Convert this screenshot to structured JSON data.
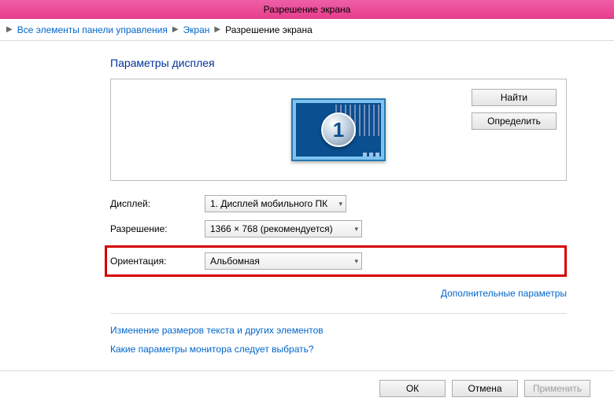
{
  "window": {
    "title": "Разрешение экрана"
  },
  "breadcrumb": {
    "item0": "Все элементы панели управления",
    "item1": "Экран",
    "item2": "Разрешение экрана"
  },
  "heading": "Параметры дисплея",
  "buttons": {
    "find": "Найти",
    "detect": "Определить"
  },
  "monitor_number": "1",
  "fields": {
    "display_label": "Дисплей:",
    "display_value": "1. Дисплей мобильного ПК",
    "resolution_label": "Разрешение:",
    "resolution_value": "1366 × 768 (рекомендуется)",
    "orientation_label": "Ориентация:",
    "orientation_value": "Альбомная"
  },
  "links": {
    "advanced": "Дополнительные параметры",
    "text_size": "Изменение размеров текста и других элементов",
    "which_monitor": "Какие параметры монитора следует выбрать?"
  },
  "footer": {
    "ok": "ОК",
    "cancel": "Отмена",
    "apply": "Применить"
  }
}
